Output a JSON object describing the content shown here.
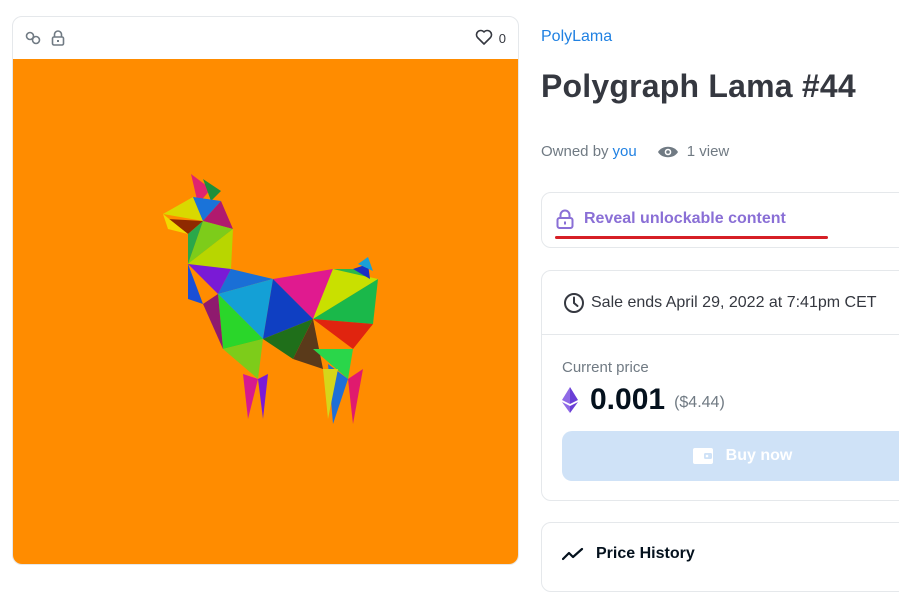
{
  "card": {
    "favorites_count": "0",
    "icons": [
      "link-icon",
      "lock-icon",
      "heart-icon"
    ],
    "background_color": "#ff8c00"
  },
  "collection_name": "PolyLama",
  "item_title": "Polygraph Lama #44",
  "owner": {
    "prefix": "Owned by",
    "name": "you",
    "views": "1 view"
  },
  "unlockable": {
    "label": "Reveal unlockable content",
    "color": "#8a6fd6"
  },
  "sale": {
    "ends_text": "Sale ends April 29, 2022 at 7:41pm CET",
    "current_price_label": "Current price",
    "price": "0.001",
    "price_usd": "($4.44)",
    "buy_label": "Buy now"
  },
  "price_history": {
    "label": "Price History"
  },
  "colors": {
    "accent": "#2081e2",
    "annotation_underline": "#d61f26"
  }
}
